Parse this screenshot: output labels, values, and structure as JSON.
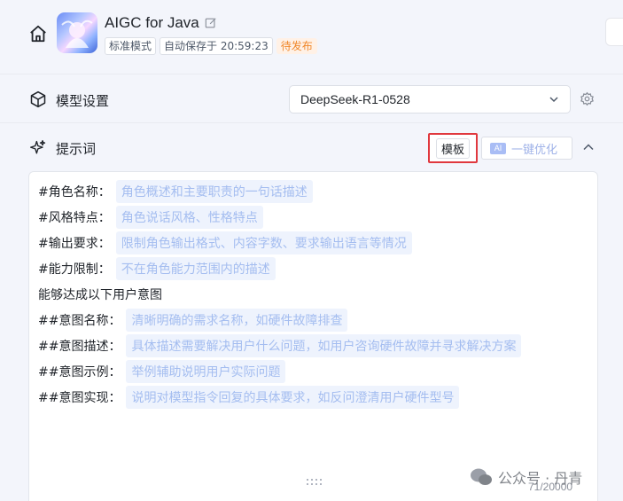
{
  "header": {
    "app_title": "AIGC for Java",
    "mode_tag": "标准模式",
    "autosave_text": "自动保存于 20:59:23",
    "status_tag": "待发布"
  },
  "model_settings": {
    "label": "模型设置",
    "selected_model": "DeepSeek-R1-0528"
  },
  "prompt": {
    "label": "提示词",
    "template_button": "模板",
    "ai_badge": "AI",
    "optimize_button": "一键优化",
    "lines": [
      {
        "key": "#角色名称：",
        "placeholder": "角色概述和主要职责的一句话描述"
      },
      {
        "key": "#风格特点：",
        "placeholder": "角色说话风格、性格特点"
      },
      {
        "key": "#输出要求：",
        "placeholder": "限制角色输出格式、内容字数、要求输出语言等情况"
      },
      {
        "key": "#能力限制：",
        "placeholder": "不在角色能力范围内的描述"
      },
      {
        "key": "能够达成以下用户意图",
        "placeholder": ""
      },
      {
        "key": "##意图名称：",
        "placeholder": "清晰明确的需求名称，如硬件故障排查"
      },
      {
        "key": "##意图描述：",
        "placeholder": "具体描述需要解决用户什么问题，如用户咨询硬件故障并寻求解决方案"
      },
      {
        "key": "##意图示例：",
        "placeholder": "举例辅助说明用户实际问题"
      },
      {
        "key": "##意图实现：",
        "placeholder": "说明对模型指令回复的具体要求，如反问澄清用户硬件型号"
      }
    ],
    "char_count": "71/20000"
  },
  "watermark": "公众号 · 丹青",
  "colors": {
    "highlight_border": "#e0383e",
    "placeholder_bg": "#eef3fd",
    "placeholder_text": "#a4bdf0",
    "status_tag_text": "#f0882b"
  }
}
